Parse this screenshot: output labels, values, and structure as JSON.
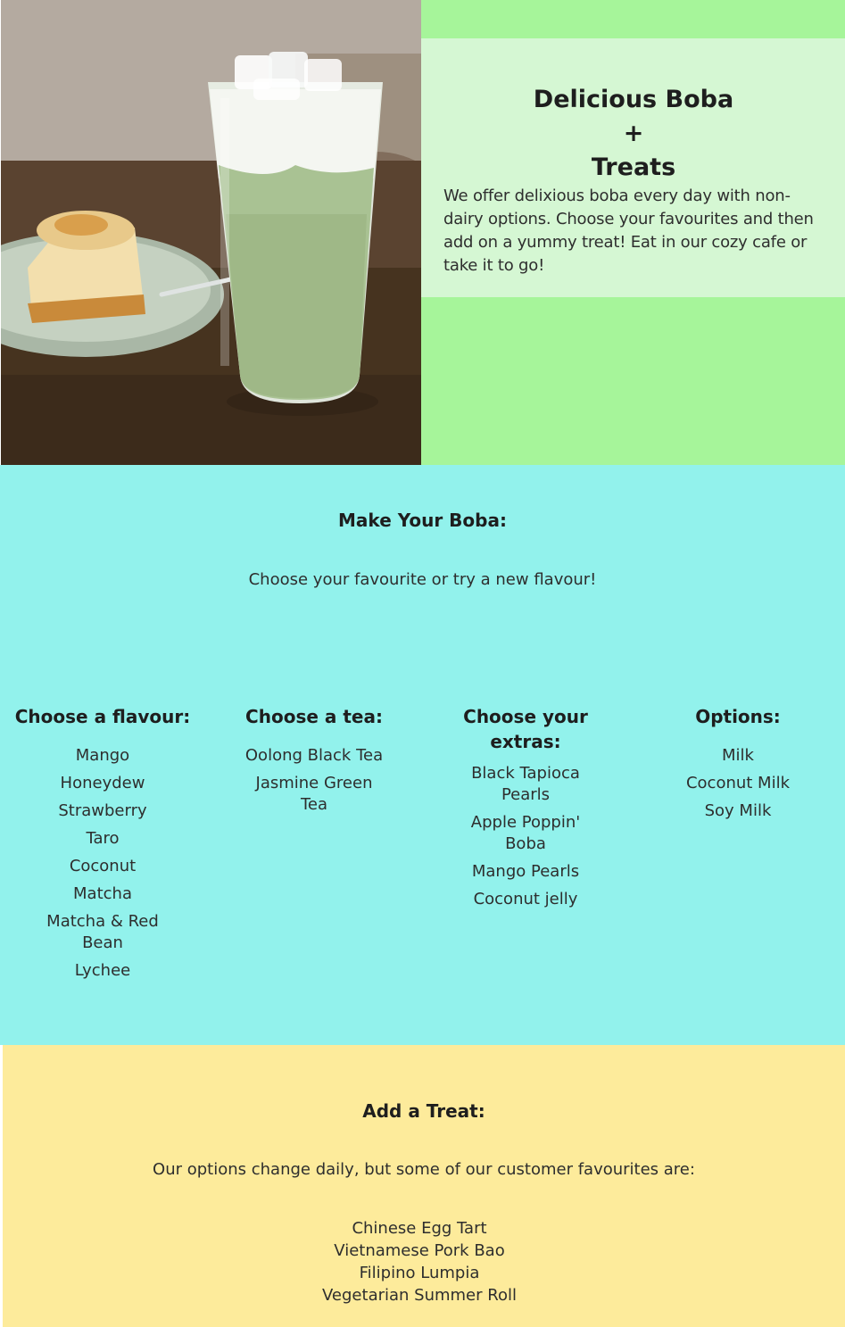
{
  "hero": {
    "image_alt": "Iced matcha boba drink beside a slice of cheesecake",
    "title_line1": "Delicious Boba",
    "title_plus": "+",
    "title_line2": "Treats",
    "description": "We offer delixious boba every day with non-dairy options. Choose your favourites and then add on a yummy treat! Eat in our cozy cafe or take it to go!",
    "colors": {
      "outer": "#a6f59a",
      "card": "#d5f7d3"
    }
  },
  "boba": {
    "heading": "Make Your Boba:",
    "subheading": "Choose your favourite or try a new flavour!",
    "background": "#92f2ec",
    "columns": [
      {
        "title": "Choose a flavour:",
        "items": [
          "Mango",
          "Honeydew",
          "Strawberry",
          "Taro",
          "Coconut",
          "Matcha",
          "Matcha & Red Bean",
          "Lychee"
        ]
      },
      {
        "title": "Choose a tea:",
        "items": [
          "Oolong Black Tea",
          "Jasmine Green Tea"
        ]
      },
      {
        "title": "Choose your extras:",
        "items": [
          "Black Tapioca Pearls",
          "Apple Poppin' Boba",
          "Mango Pearls",
          "Coconut jelly"
        ]
      },
      {
        "title": "Options:",
        "items": [
          "Milk",
          "Coconut Milk",
          "Soy Milk"
        ]
      }
    ]
  },
  "treats": {
    "heading": "Add a Treat:",
    "subheading": "Our options change daily, but some of our customer favourites are:",
    "background": "#fdeb9b",
    "items": [
      "Chinese Egg Tart",
      "Vietnamese Pork Bao",
      "Filipino Lumpia",
      "Vegetarian Summer Roll"
    ]
  }
}
